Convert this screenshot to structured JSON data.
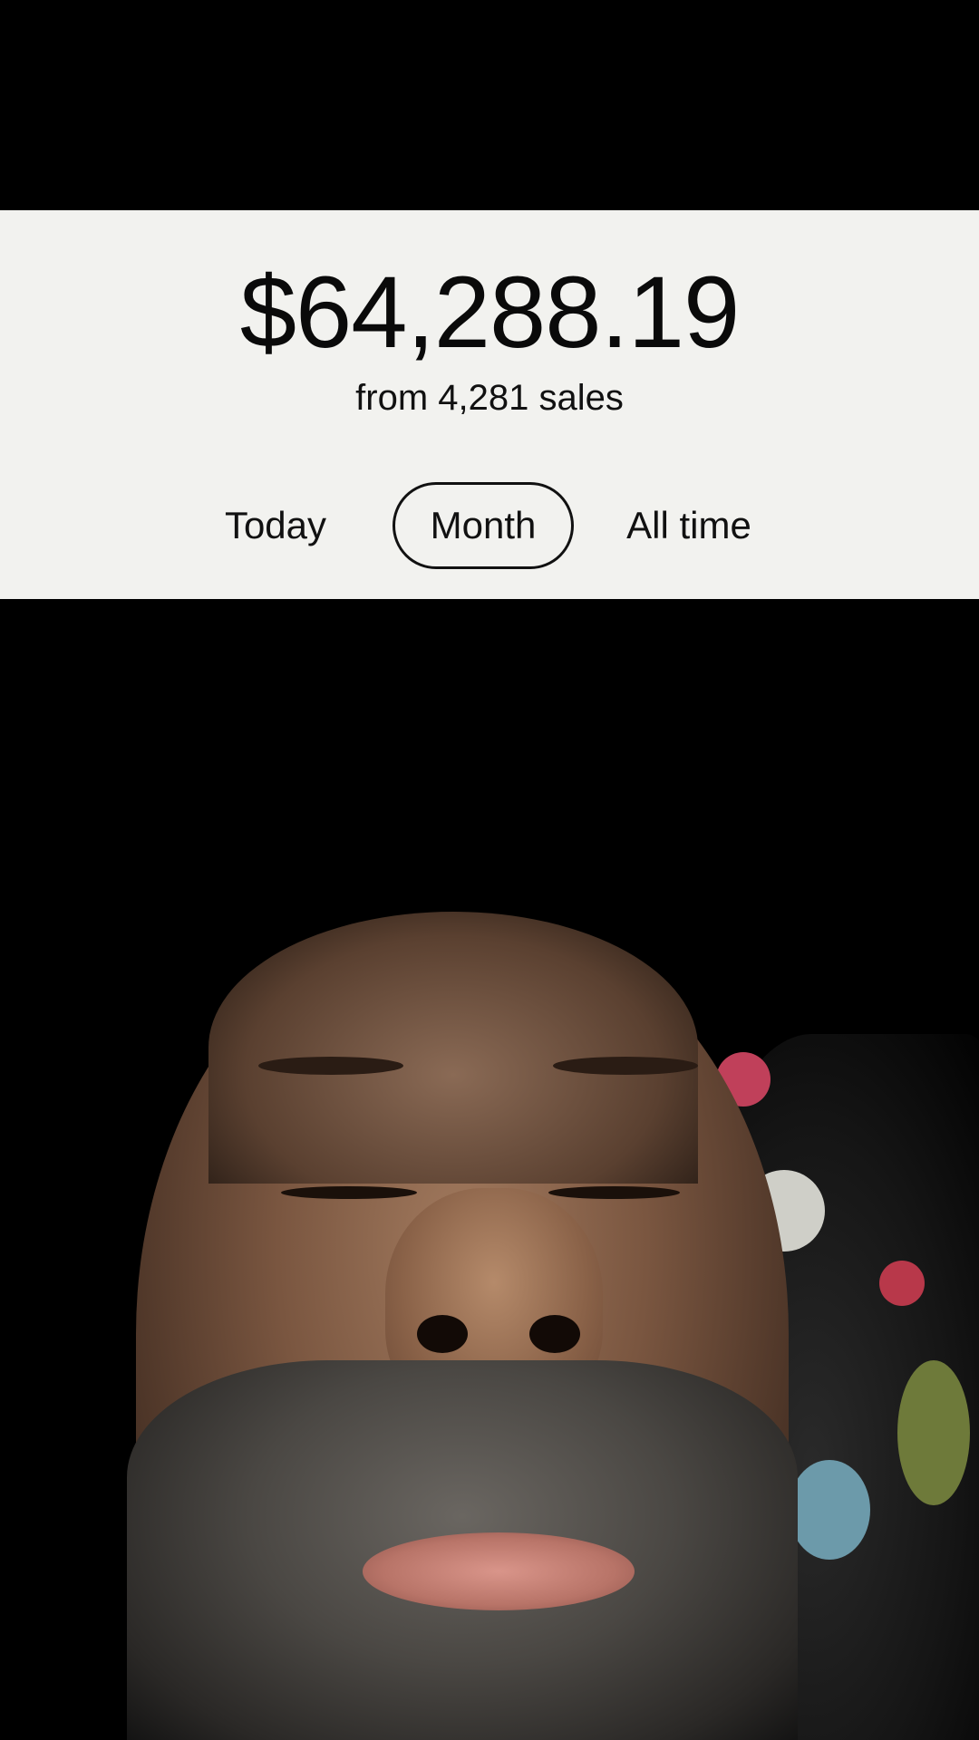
{
  "sales": {
    "amount": "$64,288.19",
    "subtitle": "from 4,281 sales"
  },
  "period_tabs": {
    "items": [
      {
        "label": "Today",
        "selected": false
      },
      {
        "label": "Month",
        "selected": true
      },
      {
        "label": "All time",
        "selected": false
      }
    ]
  },
  "colors": {
    "card_background": "#f2f2ef",
    "text": "#0a0a0a",
    "page_background": "#000000"
  }
}
